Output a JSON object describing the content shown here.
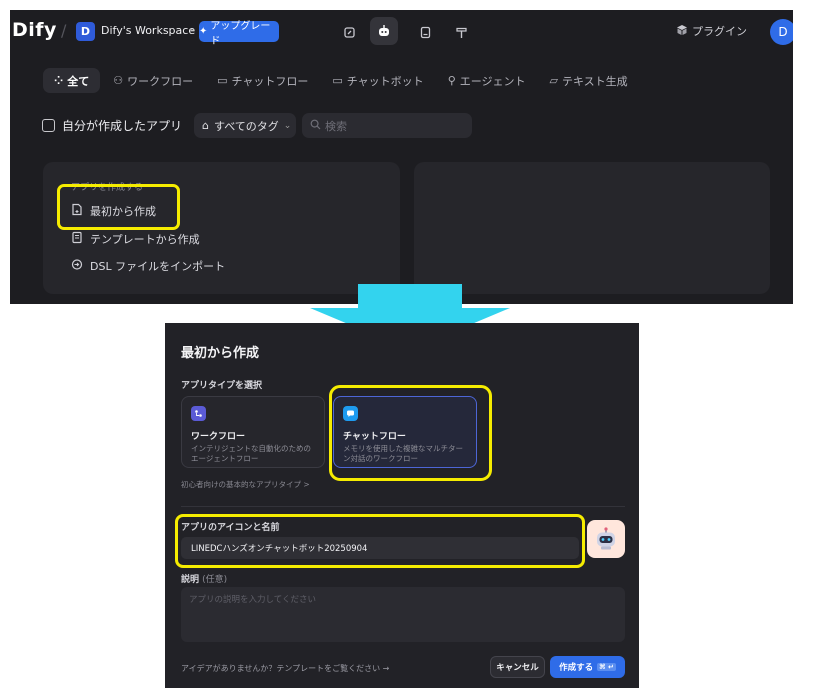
{
  "header": {
    "logo": "Dify",
    "workspace_initial": "D",
    "workspace_name": "Dify's Workspace",
    "upgrade_label": "アップグレード",
    "plugin_label": "プラグイン",
    "user_initial": "D"
  },
  "filter_tabs": [
    {
      "label": "全て",
      "icon": "grid-icon",
      "active": true
    },
    {
      "label": "ワークフロー",
      "icon": "workflow-icon",
      "active": false
    },
    {
      "label": "チャットフロー",
      "icon": "chatflow-icon",
      "active": false
    },
    {
      "label": "チャットボット",
      "icon": "chatbot-icon",
      "active": false
    },
    {
      "label": "エージェント",
      "icon": "agent-icon",
      "active": false
    },
    {
      "label": "テキスト生成",
      "icon": "text-generation-icon",
      "active": false
    }
  ],
  "filters": {
    "mine_label": "自分が作成したアプリ",
    "tag_label": "すべてのタグ",
    "search_placeholder": "検索"
  },
  "create_card": {
    "heading": "アプリを作成する",
    "items": [
      {
        "label": "最初から作成",
        "icon": "blank-file-icon"
      },
      {
        "label": "テンプレートから作成",
        "icon": "template-icon"
      },
      {
        "label": "DSL ファイルをインポート",
        "icon": "import-icon"
      }
    ]
  },
  "dialog": {
    "title": "最初から作成",
    "type_section_label": "アプリタイプを選択",
    "types": [
      {
        "name": "ワークフロー",
        "desc": "インテリジェントな自動化のためのエージェントフロー",
        "color": "#5b5bd6",
        "selected": false
      },
      {
        "name": "チャットフロー",
        "desc": "メモリを使用した複雑なマルチターン対話のワークフロー",
        "color": "#1e9bf0",
        "selected": true
      }
    ],
    "beginner_link": "初心者向けの基本的なアプリタイプ >",
    "name_section_label": "アプリのアイコンと名前",
    "name_value": "LINEDCハンズオンチャットボット20250904",
    "desc_section_label": "説明",
    "desc_optional": "(任意)",
    "desc_placeholder": "アプリの説明を入力してください",
    "idea_link": "アイデアがありませんか？テンプレートをご覧ください →",
    "cancel_label": "キャンセル",
    "create_label": "作成する",
    "create_shortcut": "⌘ ↵"
  },
  "colors": {
    "accent": "#2f6ce8",
    "highlight": "#f5ec00",
    "arrow": "#33d3ee"
  }
}
